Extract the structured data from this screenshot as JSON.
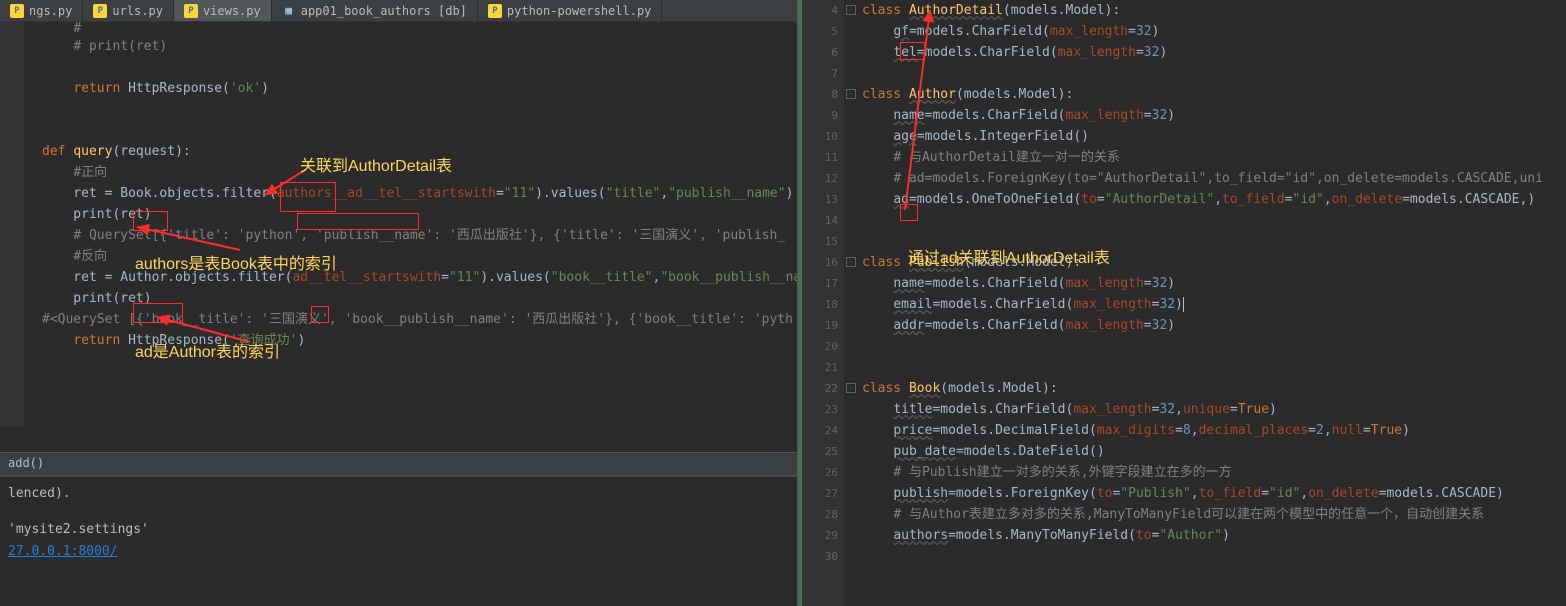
{
  "tabs": [
    {
      "label": "ngs.py",
      "icon": "py"
    },
    {
      "label": "urls.py",
      "icon": "py"
    },
    {
      "label": "views.py",
      "icon": "py",
      "active": true
    },
    {
      "label": "app01_book_authors [db]",
      "icon": "db"
    },
    {
      "label": "python-powershell.py",
      "icon": "py"
    }
  ],
  "left_code": {
    "lines": [
      {
        "html": "    <span class='cm'># print(ret)</span>"
      },
      {
        "html": ""
      },
      {
        "html": "    <span class='kw'>return</span> HttpResponse(<span class='str'>'ok'</span>)"
      },
      {
        "html": ""
      },
      {
        "html": ""
      },
      {
        "html": "<span class='kw'>def</span> <span class='fn'>query</span>(request):"
      },
      {
        "html": "    <span class='cm'>#正向</span>"
      },
      {
        "html": "    ret = Book.objects.filter(<span class='par'>authors__ad__tel__startswith</span>=<span class='str'>\"11\"</span>).values(<span class='str'>\"title\"</span>,<span class='str'>\"publish__name\"</span>)"
      },
      {
        "html": "    print(ret)"
      },
      {
        "html": "    <span class='cm'># QuerySet[{'title': 'python', 'publish__name': '西瓜出版社'}, {'title': '三国演义', 'publish_</span>"
      },
      {
        "html": "    <span class='cm'>#反向</span>"
      },
      {
        "html": "    ret = Author.objects.filter(<span class='par'>ad__tel__startswith</span>=<span class='str'>\"11\"</span>).values(<span class='str'>\"book__title\"</span>,<span class='str'>\"book__publish__nam</span>"
      },
      {
        "html": "    print(ret)"
      },
      {
        "html": "<span class='cm'>#&lt;QuerySet [{'book__title': '三国演义', 'book__publish__name': '西瓜出版社'}, {'book__title': 'pyth</span>"
      },
      {
        "html": "    <span class='kw'>return</span> HttpResponse(<span class='str'>'查询成功'</span>)"
      },
      {
        "html": ""
      }
    ]
  },
  "breadcrumb": "add()",
  "console": {
    "l1": "lenced).",
    "l2": "'mysite2.settings'",
    "l3": "27.0.0.1:8000/"
  },
  "annotations": {
    "a1": "关联到AuthorDetail表",
    "a2": "authors是表Book表中的索引",
    "a3": "ad是Author表的索引",
    "a4": "通过ad关联到AuthorDetail表"
  },
  "right_lines_start": 4,
  "right_code": {
    "lines": [
      {
        "n": 4,
        "html": "<span class='kw'>class</span> <span class='fn underl'>AuthorDetail</span>(models.Model):"
      },
      {
        "n": 5,
        "html": "    <span class='underl'>gf</span>=models.CharField(<span class='par'>max_length</span>=<span class='num'>32</span>)"
      },
      {
        "n": 6,
        "html": "    <span class='underl'>tel</span>=models.CharField(<span class='par'>max_length</span>=<span class='num'>32</span>)"
      },
      {
        "n": 7,
        "html": ""
      },
      {
        "n": 8,
        "html": "<span class='kw'>class</span> <span class='fn underl'>Author</span>(models.Model):"
      },
      {
        "n": 9,
        "html": "    <span class='underl'>name</span>=models.CharField(<span class='par'>max_length</span>=<span class='num'>32</span>)"
      },
      {
        "n": 10,
        "html": "    <span class='underl'>age</span>=models.IntegerField()"
      },
      {
        "n": 11,
        "html": "    <span class='cm'># 与AuthorDetail建立一对一的关系</span>"
      },
      {
        "n": 12,
        "html": "    <span class='cm'># ad=models.ForeignKey(to=\"AuthorDetail\",to_field=\"id\",on_delete=models.CASCADE,uni</span>"
      },
      {
        "n": 13,
        "html": "    <span class='underl'>ad</span>=models.OneToOneField(<span class='par'>to</span>=<span class='str'>\"AuthorDetail\"</span>,<span class='par'>to_field</span>=<span class='str'>\"id\"</span>,<span class='par'>on_delete</span>=models.CASCADE,)"
      },
      {
        "n": 14,
        "html": ""
      },
      {
        "n": 15,
        "html": ""
      },
      {
        "n": 16,
        "html": "<span class='kw'>class</span> <span class='fn underl'>Publish</span>(models.Model):"
      },
      {
        "n": 17,
        "html": "    <span class='underl'>name</span>=models.CharField(<span class='par'>max_length</span>=<span class='num'>32</span>)"
      },
      {
        "n": 18,
        "html": "    <span class='underl'>email</span>=models.CharField(<span class='par'>max_length</span>=<span class='num'>32</span>)<span class='caret'></span>"
      },
      {
        "n": 19,
        "html": "    <span class='underl'>addr</span>=models.CharField(<span class='par'>max_length</span>=<span class='num'>32</span>)"
      },
      {
        "n": 20,
        "html": ""
      },
      {
        "n": 21,
        "html": ""
      },
      {
        "n": 22,
        "html": "<span class='kw'>class</span> <span class='fn underl'>Book</span>(models.Model):"
      },
      {
        "n": 23,
        "html": "    <span class='underl'>title</span>=models.CharField(<span class='par'>max_length</span>=<span class='num'>32</span>,<span class='par'>unique</span>=<span class='kw'>True</span>)"
      },
      {
        "n": 24,
        "html": "    <span class='underl'>price</span>=models.DecimalField(<span class='par'>max_digits</span>=<span class='num'>8</span>,<span class='par'>decimal_places</span>=<span class='num'>2</span>,<span class='par'>null</span>=<span class='kw'>True</span>)"
      },
      {
        "n": 25,
        "html": "    <span class='underl'>pub_date</span>=models.DateField()"
      },
      {
        "n": 26,
        "html": "    <span class='cm'># 与Publish建立一对多的关系,外键字段建立在多的一方</span>"
      },
      {
        "n": 27,
        "html": "    <span class='underl'>publish</span>=models.ForeignKey(<span class='par'>to</span>=<span class='str'>\"Publish\"</span>,<span class='par'>to_field</span>=<span class='str'>\"id\"</span>,<span class='par'>on_delete</span>=models.CASCADE)"
      },
      {
        "n": 28,
        "html": "    <span class='cm'># 与Author表建立多对多的关系,ManyToManyField可以建在两个模型中的任意一个，自动创建关系</span>"
      },
      {
        "n": 29,
        "html": "    <span class='underl'>authors</span>=models.ManyToManyField(<span class='par'>to</span>=<span class='str'>\"Author\"</span>)"
      },
      {
        "n": 30,
        "html": ""
      }
    ]
  }
}
